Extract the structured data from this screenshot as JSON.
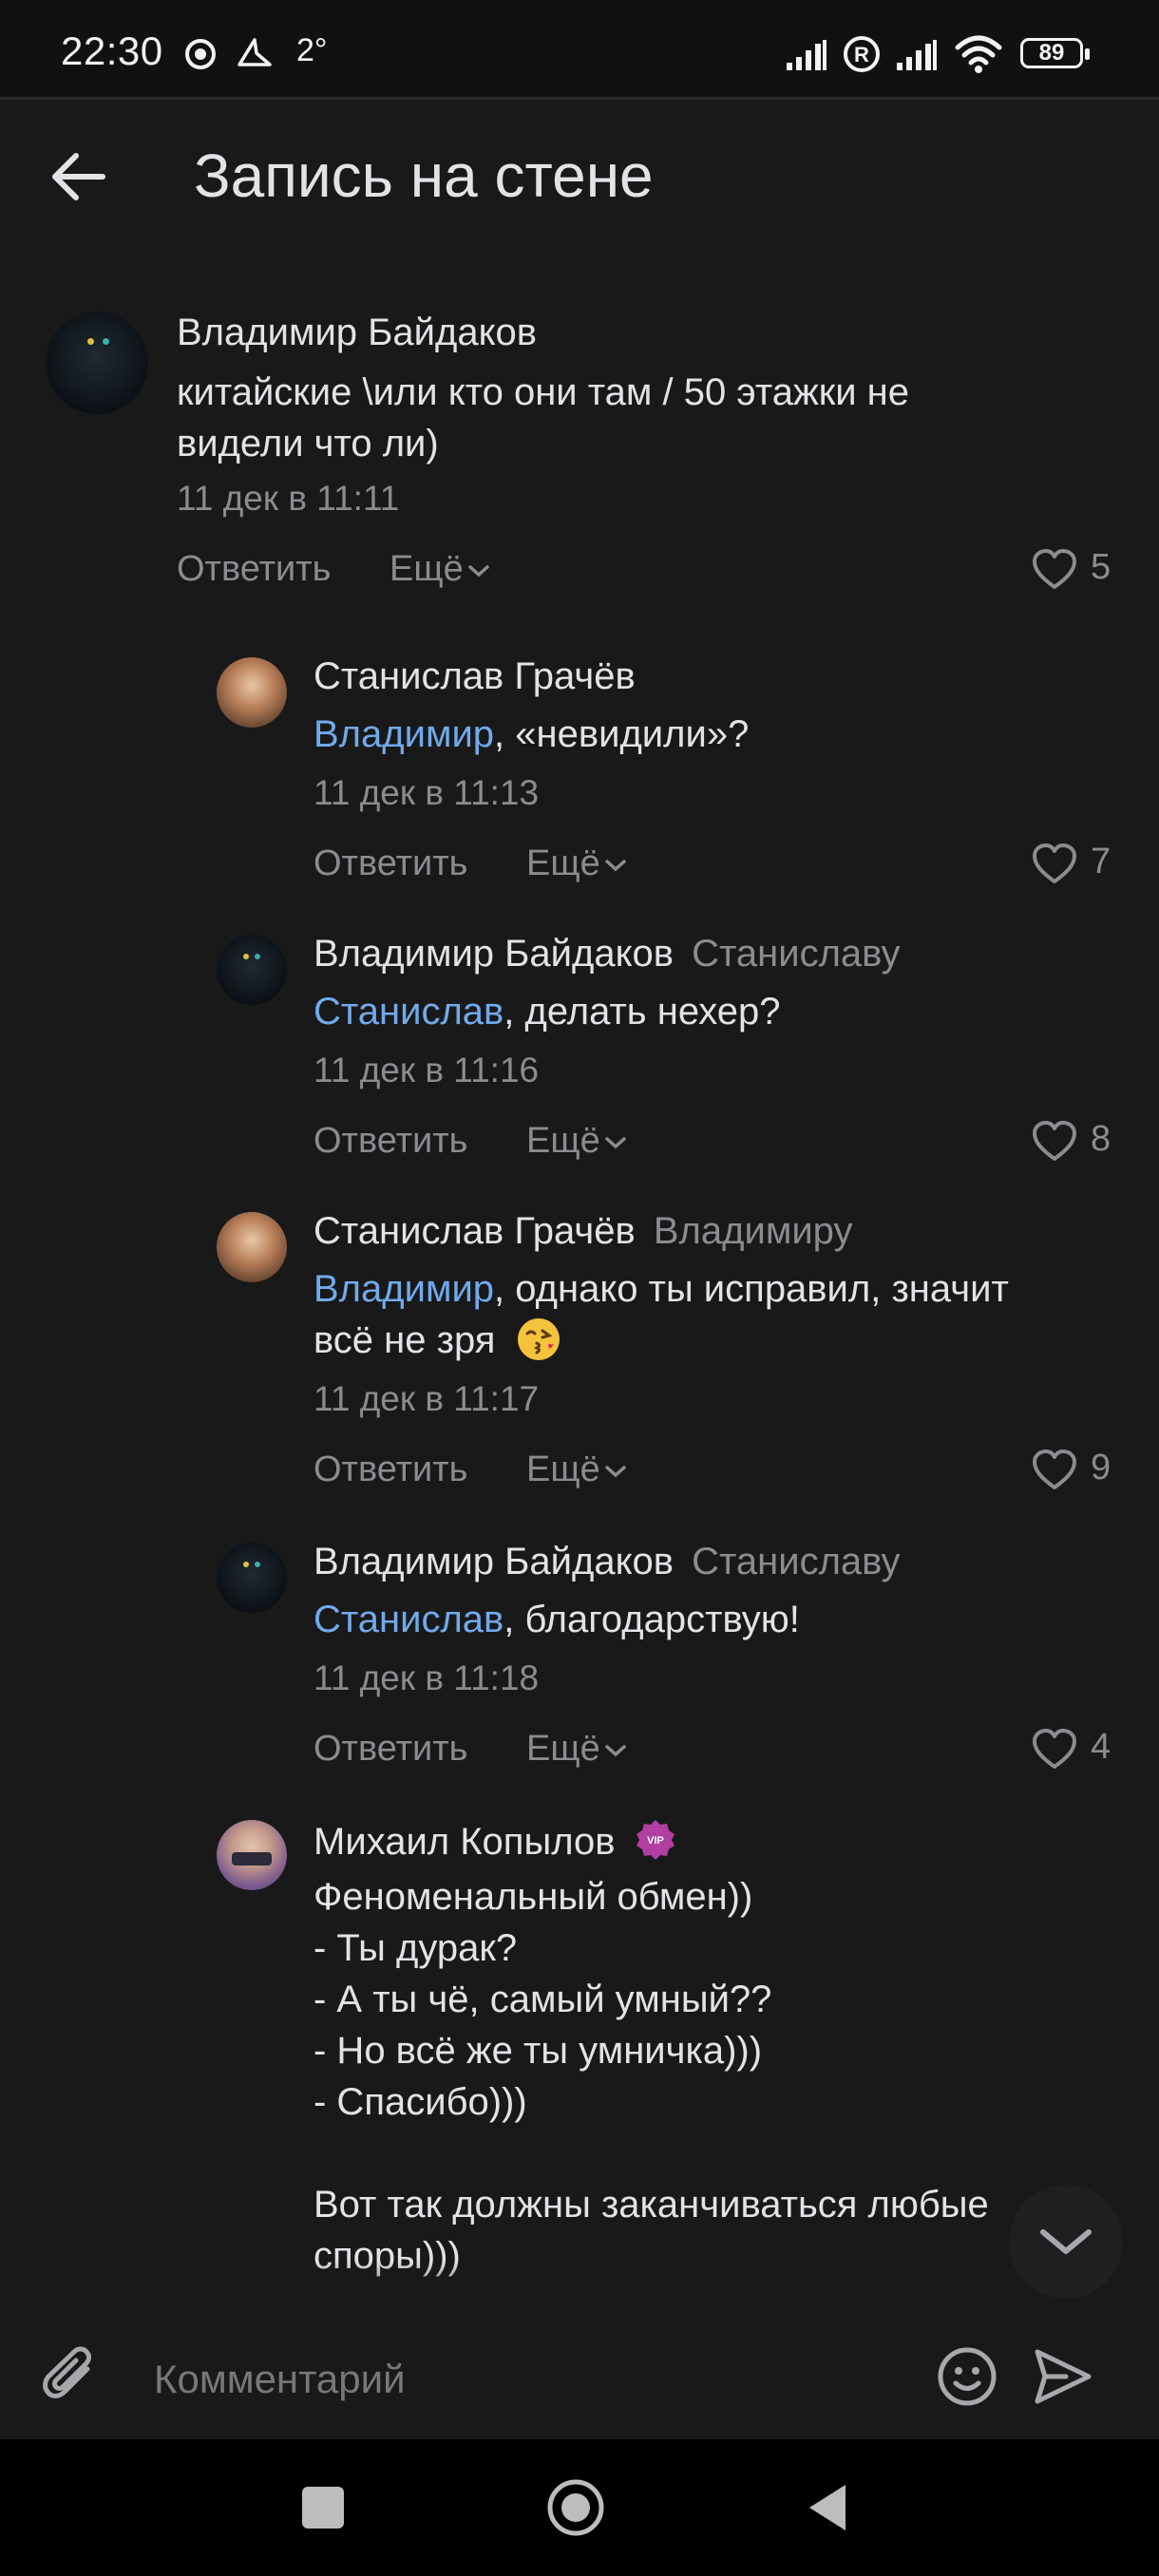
{
  "status": {
    "time": "22:30",
    "temperature": "2°",
    "battery": "89",
    "icons": [
      "chrome-icon",
      "app-notification-icon",
      "signal-icon",
      "roaming-icon",
      "signal-icon-2",
      "wifi-icon",
      "battery-icon"
    ]
  },
  "header": {
    "title": "Запись на стене",
    "back_icon": "arrow-left-icon"
  },
  "comments": [
    {
      "author": "Владимир Байдаков",
      "reply_to": "",
      "mention": "",
      "text": "китайские \\или кто они там / 50 этажки не",
      "text_line2": "видели что ли)",
      "date": "11 дек в 11:11",
      "reply_label": "Ответить",
      "more_label": "Ещё",
      "likes": "5"
    },
    {
      "author": "Станислав Грачёв",
      "reply_to": "",
      "mention": "Владимир",
      "text": ", «невидили»?",
      "date": "11 дек в 11:13",
      "reply_label": "Ответить",
      "more_label": "Ещё",
      "likes": "7"
    },
    {
      "author": "Владимир Байдаков",
      "reply_to": "Станиславу",
      "mention": "Станислав",
      "text": ", делать нехер?",
      "date": "11 дек в 11:16",
      "reply_label": "Ответить",
      "more_label": "Ещё",
      "likes": "8"
    },
    {
      "author": "Станислав Грачёв",
      "reply_to": "Владимиру",
      "mention": "Владимир",
      "text": ", однако ты исправил, значит",
      "text_line2": "всё не зря",
      "date": "11 дек в 11:17",
      "reply_label": "Ответить",
      "more_label": "Ещё",
      "likes": "9"
    },
    {
      "author": "Владимир Байдаков",
      "reply_to": "Станиславу",
      "mention": "Станислав",
      "text": ", благодарствую!",
      "date": "11 дек в 11:18",
      "reply_label": "Ответить",
      "more_label": "Ещё",
      "likes": "4"
    },
    {
      "author": "Михаил Копылов",
      "badge": "VIP",
      "lines": [
        "Феноменальный обмен))",
        "- Ты дурак?",
        "- А ты чё, самый умный??",
        "- Но всё же ты умничка)))",
        "- Спасибо)))",
        "",
        "Вот так должны заканчиваться любые",
        "споры)))"
      ]
    }
  ],
  "composer": {
    "placeholder": "Комментарий"
  },
  "colors": {
    "background": "#19191a",
    "text": "#e1e3e6",
    "secondary": "#8a8c90",
    "mention": "#71aaeb"
  }
}
